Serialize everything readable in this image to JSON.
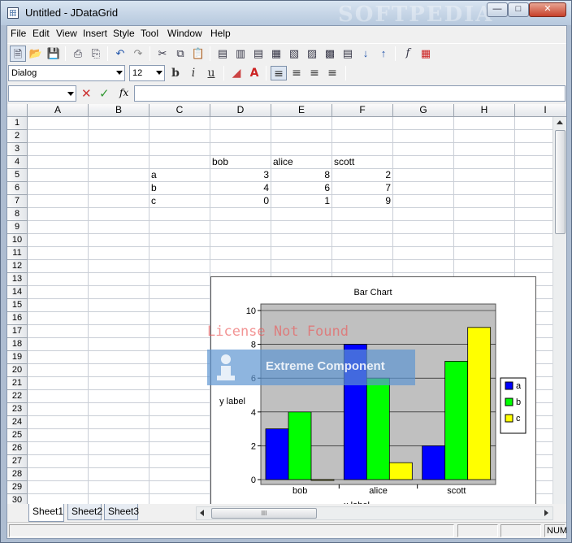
{
  "window": {
    "title": "Untitled - JDataGrid",
    "watermark": "SOFTPEDIA"
  },
  "menu": [
    "File",
    "Edit",
    "View",
    "Insert",
    "Style",
    "Tool",
    "Window",
    "Help"
  ],
  "format": {
    "font": "Dialog",
    "size": "12",
    "bold": "b",
    "italic": "i",
    "underline": "u"
  },
  "formula": {
    "cellref": "",
    "fx": "fx",
    "value": ""
  },
  "columns": [
    "A",
    "B",
    "C",
    "D",
    "E",
    "F",
    "G",
    "H",
    "I"
  ],
  "rows": [
    "1",
    "2",
    "3",
    "4",
    "5",
    "6",
    "7",
    "8",
    "9",
    "10",
    "11",
    "12",
    "13",
    "14",
    "15",
    "16",
    "17",
    "18",
    "19",
    "20",
    "21",
    "22",
    "23",
    "24",
    "25",
    "26",
    "27",
    "28",
    "29",
    "30"
  ],
  "cells": {
    "D4": "bob",
    "E4": "alice",
    "F4": "scott",
    "C5": "a",
    "D5": "3",
    "E5": "8",
    "F5": "2",
    "C6": "b",
    "D6": "4",
    "E6": "6",
    "F6": "7",
    "C7": "c",
    "D7": "0",
    "E7": "1",
    "F7": "9"
  },
  "chart_data": {
    "type": "bar",
    "title": "Bar Chart",
    "xlabel": "x label",
    "ylabel": "y label",
    "categories": [
      "bob",
      "alice",
      "scott"
    ],
    "series": [
      {
        "name": "a",
        "values": [
          3,
          8,
          2
        ],
        "color": "#0000ff"
      },
      {
        "name": "b",
        "values": [
          4,
          6,
          7
        ],
        "color": "#00ff00"
      },
      {
        "name": "c",
        "values": [
          0,
          1,
          9
        ],
        "color": "#ffff00"
      }
    ],
    "yticks": [
      "0",
      "2",
      "4",
      "6",
      "8",
      "10"
    ],
    "ylim": [
      0,
      10
    ],
    "grid": true,
    "legend": "right"
  },
  "watermarks": {
    "license": "License Not Found",
    "extreme": "Extreme Component"
  },
  "sheets": [
    "Sheet1",
    "Sheet2",
    "Sheet3"
  ],
  "scroll_grip": "III",
  "status": {
    "num": "NUM"
  }
}
